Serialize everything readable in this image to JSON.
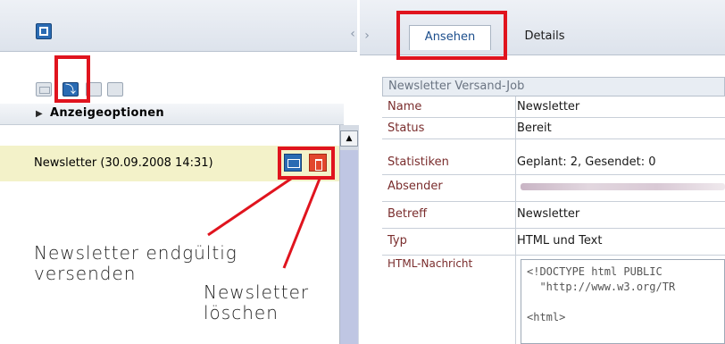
{
  "left": {
    "options_label": "Anzeigeoptionen",
    "newsletter_item": "Newsletter (30.09.2008 14:31)"
  },
  "annotations": {
    "send": [
      "Newsletter endgültig",
      "versenden"
    ],
    "delete": [
      "Newsletter",
      "löschen"
    ]
  },
  "tabs": [
    {
      "label": "Ansehen",
      "active": true
    },
    {
      "label": "Details",
      "active": false
    }
  ],
  "job": {
    "title": "Newsletter Versand-Job",
    "rows": [
      {
        "label": "Name",
        "value": "Newsletter"
      },
      {
        "label": "Status",
        "value": "Bereit"
      },
      {
        "label": "Statistiken",
        "value": "Geplant: 2, Gesendet: 0"
      },
      {
        "label": "Absender",
        "value": ""
      },
      {
        "label": "Betreff",
        "value": "Newsletter"
      },
      {
        "label": "Typ",
        "value": "HTML und Text"
      },
      {
        "label": "HTML-Nachricht",
        "value": ""
      }
    ],
    "html_preview": "<!DOCTYPE html PUBLIC\n  \"http://www.w3.org/TR\n\n<html>"
  },
  "colors": {
    "highlight": "#e0141e",
    "accent_blue": "#2a6bb3",
    "delete_red": "#e2472c",
    "selected_row": "#f3f2c9"
  }
}
